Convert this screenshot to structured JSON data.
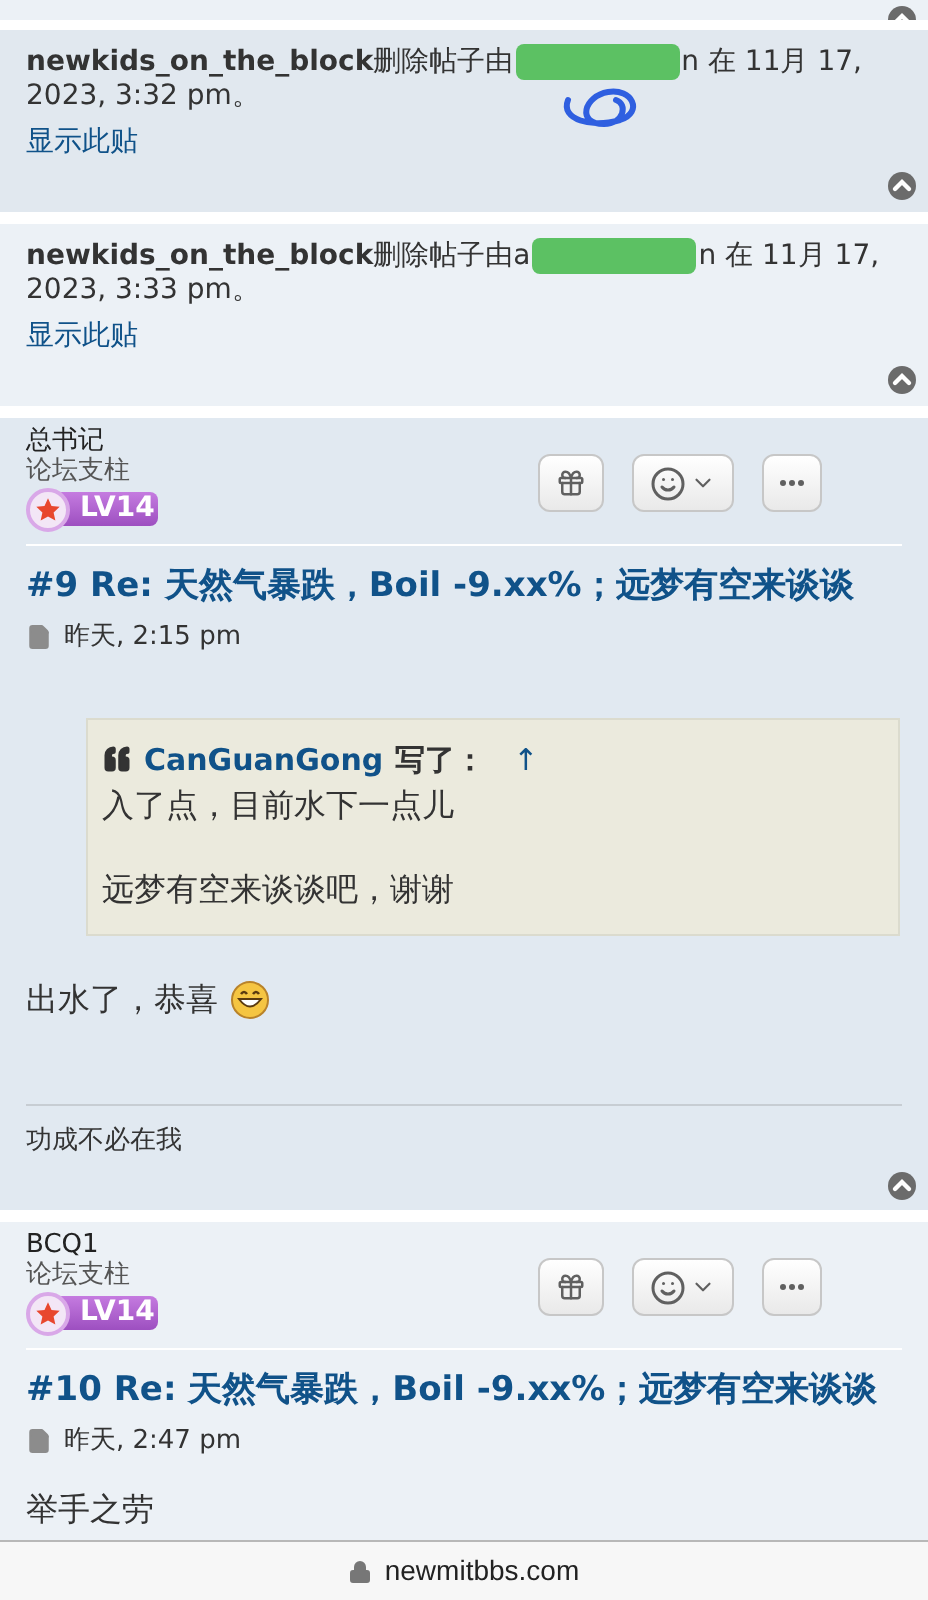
{
  "posts": [
    {
      "kind": "deleted",
      "notice_before": "**newkids_on_the_block**删除帖子由",
      "notice_after": "n 在 11月 17,",
      "notice_line2": "2023, 3:32 pm。",
      "show_link": "显示此贴",
      "scribble": true
    },
    {
      "kind": "deleted",
      "notice_before": "**newkids_on_the_block**删除帖子由a",
      "notice_after": "n 在 11月 17,",
      "notice_line2": "2023, 3:33 pm。",
      "show_link": "显示此贴",
      "scribble": false
    },
    {
      "kind": "post",
      "author": "总书记",
      "rank": "论坛支柱",
      "level_badge": "LV14",
      "title": "#9 Re: 天然气暴跌，Boil -9.xx%；远梦有空来谈谈",
      "time": "昨天, 2:15 pm",
      "quote": {
        "author": "CanGuanGong",
        "wrote": "写了：",
        "up": "↑",
        "paragraphs": [
          "入了点，目前水下一点儿",
          "远梦有空来谈谈吧，谢谢"
        ]
      },
      "body": "出水了，恭喜",
      "emoji": true,
      "signature": "功成不必在我"
    },
    {
      "kind": "post",
      "author": "BCQ1",
      "rank": "论坛支柱",
      "level_badge": "LV14",
      "title": "#10 Re: 天然气暴跌，Boil -9.xx%；远梦有空来谈谈",
      "time": "昨天, 2:47 pm",
      "body": "举手之劳",
      "emoji": false
    }
  ],
  "address_bar": {
    "domain": "newmitbbs.com"
  }
}
